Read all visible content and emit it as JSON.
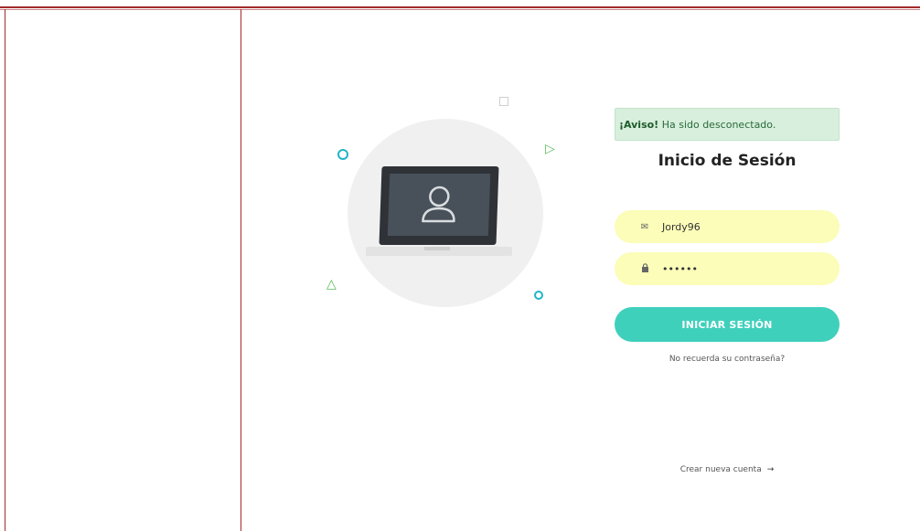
{
  "alert": {
    "strong": "¡Aviso!",
    "text": " Ha sido desconectado."
  },
  "login": {
    "title": "Inicio de Sesión",
    "username_value": "Jordy96",
    "password_value": "••••••",
    "submit_label": "INICIAR SESIÓN",
    "forgot_label": "No recuerda su contraseña?",
    "create_label": "Crear nueva cuenta",
    "create_arrow": "→"
  },
  "icons": {
    "user_field": "envelope-icon",
    "password_field": "lock-icon",
    "laptop_user": "user-icon"
  },
  "colors": {
    "button": "#3fd0bc",
    "alert_bg": "#d7efdc",
    "field_bg": "#fbfdb8",
    "accent_ring": "#1fb5c9",
    "accent_triangle": "#5bbd5b"
  }
}
